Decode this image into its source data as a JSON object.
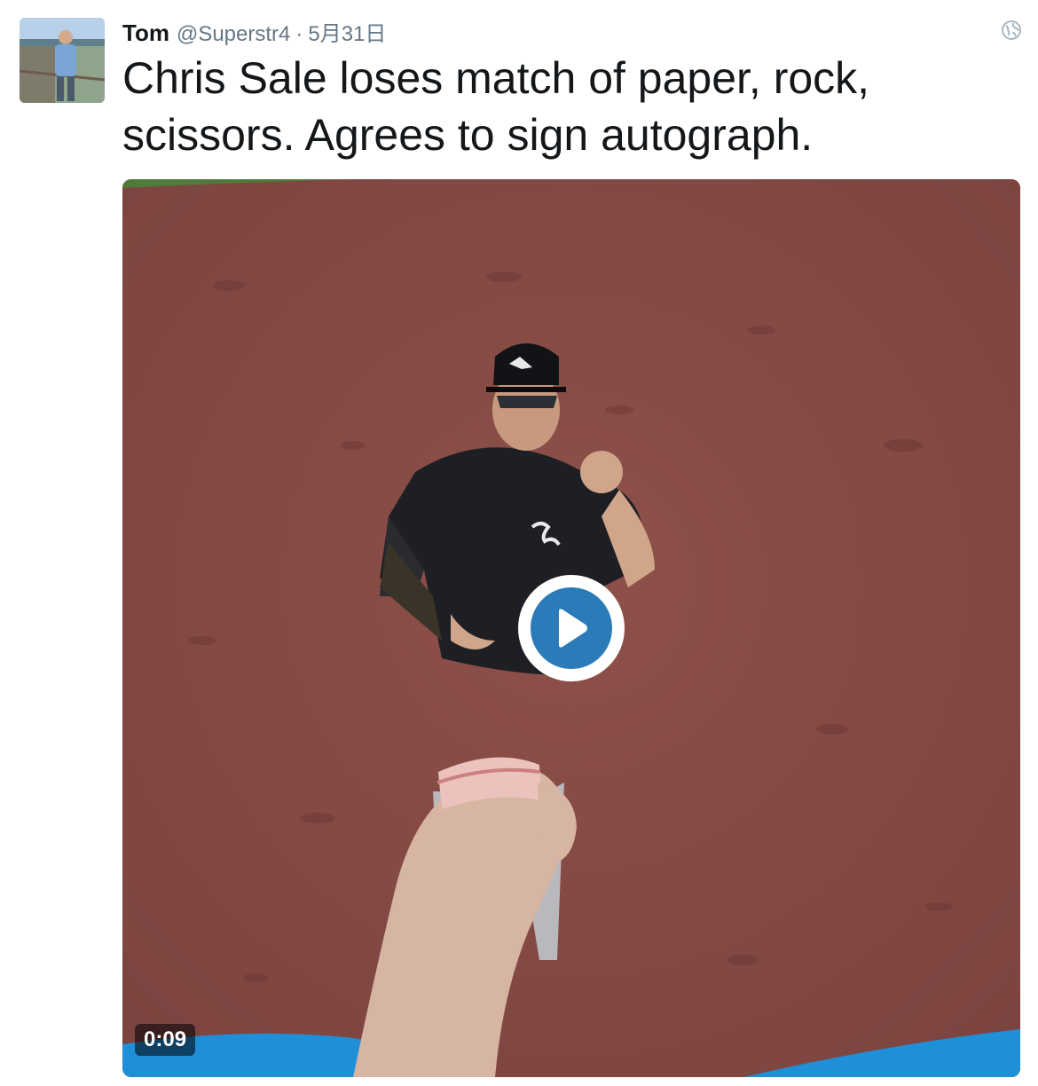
{
  "tweet": {
    "author_name": "Tom",
    "handle": "@Superstr4",
    "separator": "·",
    "date": "5月31日",
    "text": "Chris Sale loses match of paper, rock, scissors. Agrees to sign autograph.",
    "visibility_icon": "globe-icon",
    "avatar_icon": "avatar"
  },
  "media": {
    "type": "video",
    "duration": "0:09",
    "play_icon": "play-icon",
    "colors": {
      "play_button": "#2b7bb9",
      "infield_dirt": "#8a4d48",
      "bleacher_blue": "#1f8fd8"
    }
  }
}
